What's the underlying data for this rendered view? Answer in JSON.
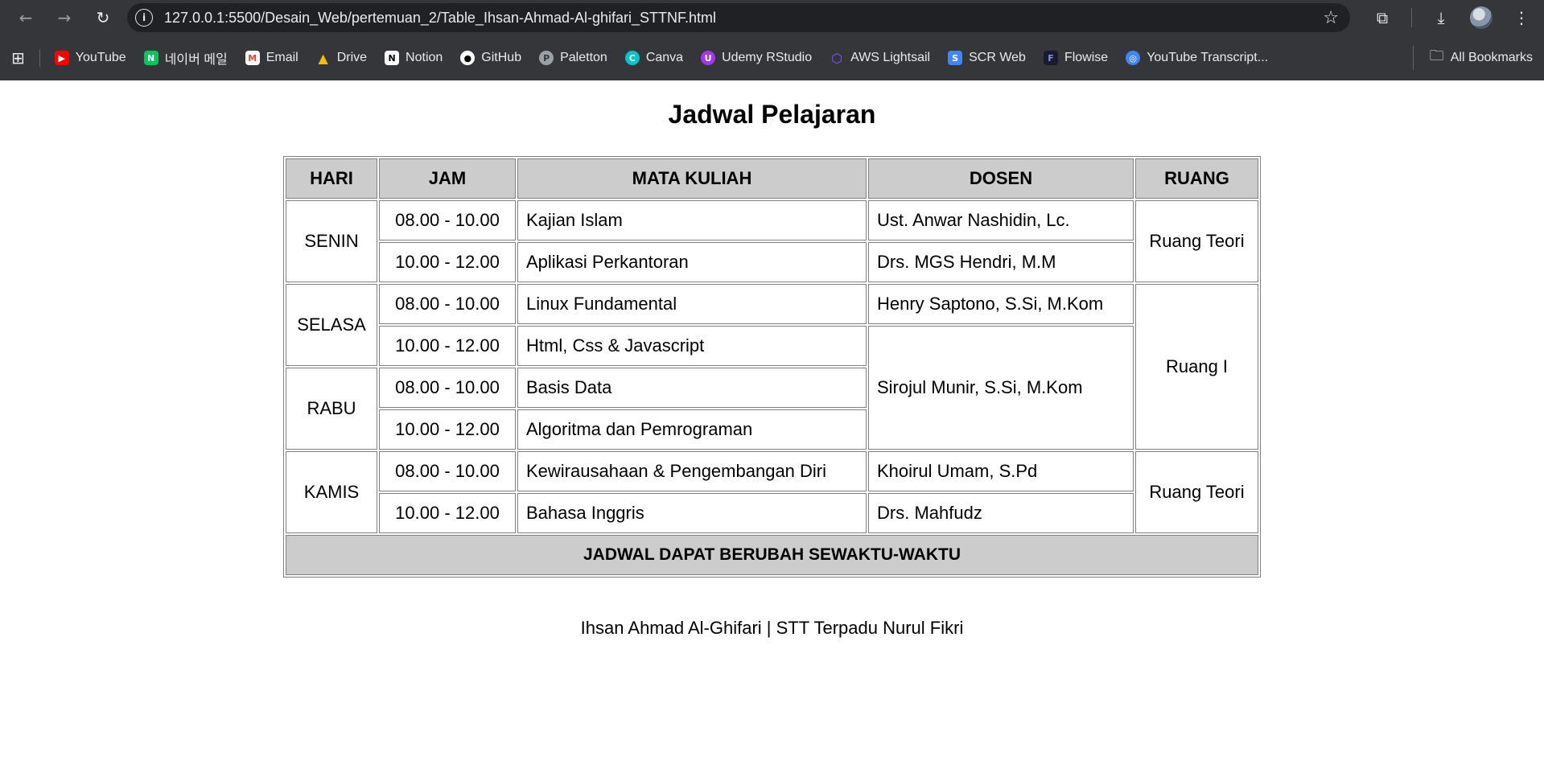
{
  "browser": {
    "url": "127.0.0.1:5500/Desain_Web/pertemuan_2/Table_Ihsan-Ahmad-Al-ghifari_STTNF.html",
    "bookmarks": [
      {
        "label": "YouTube",
        "icon": "youtube-icon",
        "color": "#ff0000"
      },
      {
        "label": "네이버 메일",
        "icon": "naver-icon",
        "color": "#03c75a"
      },
      {
        "label": "Email",
        "icon": "gmail-icon",
        "color": "#ea4335"
      },
      {
        "label": "Drive",
        "icon": "drive-icon",
        "color": "#1fa463"
      },
      {
        "label": "Notion",
        "icon": "notion-icon",
        "color": "#ffffff"
      },
      {
        "label": "GitHub",
        "icon": "github-icon",
        "color": "#ffffff"
      },
      {
        "label": "Paletton",
        "icon": "paletton-icon",
        "color": "#9aa0a6"
      },
      {
        "label": "Canva",
        "icon": "canva-icon",
        "color": "#00c4cc"
      },
      {
        "label": "Udemy RStudio",
        "icon": "udemy-icon",
        "color": "#a435f0"
      },
      {
        "label": "AWS Lightsail",
        "icon": "aws-icon",
        "color": "#8c4fff"
      },
      {
        "label": "SCR Web",
        "icon": "scr-icon",
        "color": "#4285f4"
      },
      {
        "label": "Flowise",
        "icon": "flowise-icon",
        "color": "#1a1a2e"
      },
      {
        "label": "YouTube Transcript...",
        "icon": "transcript-icon",
        "color": "#4285f4"
      }
    ],
    "all_bookmarks": "All Bookmarks"
  },
  "page": {
    "title": "Jadwal Pelajaran",
    "headers": {
      "hari": "HARI",
      "jam": "JAM",
      "mata_kuliah": "MATA KULIAH",
      "dosen": "DOSEN",
      "ruang": "RUANG"
    },
    "days": {
      "senin": "SENIN",
      "selasa": "SELASA",
      "rabu": "RABU",
      "kamis": "KAMIS"
    },
    "rows": [
      {
        "jam": "08.00 - 10.00",
        "mata_kuliah": "Kajian Islam",
        "dosen": "Ust. Anwar Nashidin, Lc."
      },
      {
        "jam": "10.00 - 12.00",
        "mata_kuliah": "Aplikasi Perkantoran",
        "dosen": "Drs. MGS Hendri, M.M"
      },
      {
        "jam": "08.00 - 10.00",
        "mata_kuliah": "Linux Fundamental",
        "dosen": "Henry Saptono, S.Si, M.Kom"
      },
      {
        "jam": "10.00 - 12.00",
        "mata_kuliah": "Html, Css & Javascript",
        "dosen": "Sirojul Munir, S.Si, M.Kom"
      },
      {
        "jam": "08.00 - 10.00",
        "mata_kuliah": "Basis Data",
        "dosen": ""
      },
      {
        "jam": "10.00 - 12.00",
        "mata_kuliah": "Algoritma dan Pemrograman",
        "dosen": ""
      },
      {
        "jam": "08.00 - 10.00",
        "mata_kuliah": "Kewirausahaan & Pengembangan Diri",
        "dosen": "Khoirul Umam, S.Pd"
      },
      {
        "jam": "10.00 - 12.00",
        "mata_kuliah": "Bahasa Inggris",
        "dosen": "Drs. Mahfudz"
      }
    ],
    "rooms": {
      "senin": "Ruang Teori",
      "selasa_rabu": "Ruang I",
      "kamis": "Ruang Teori"
    },
    "footer_note": "JADWAL DAPAT BERUBAH SEWAKTU-WAKTU",
    "credit": "Ihsan Ahmad Al-Ghifari | STT Terpadu Nurul Fikri"
  }
}
